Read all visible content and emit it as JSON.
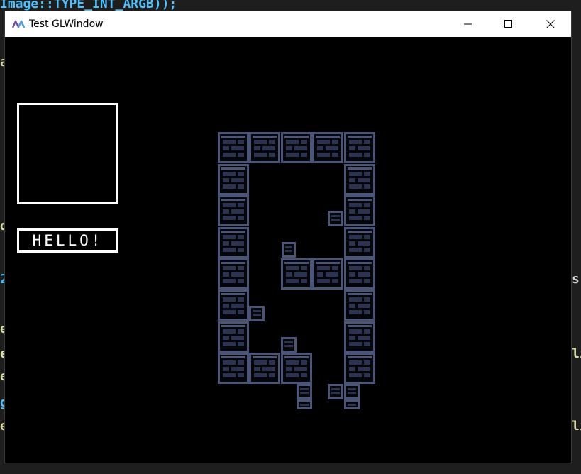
{
  "background": {
    "code_fragments": [
      {
        "text": "Image::TYPE_INT_ARGB));",
        "color": "#4fc1ff"
      },
      {
        "text": "a",
        "color": "#dcdcaa"
      },
      {
        "text": "d",
        "color": "#dcdcaa"
      },
      {
        "text": "2",
        "color": "#4fc1ff"
      },
      {
        "text": "s(",
        "color": "#d4d4d4"
      },
      {
        "text": "e",
        "color": "#dcdcaa"
      },
      {
        "text": "e",
        "color": "#dcdcaa"
      },
      {
        "text": "li",
        "color": "#dcdcaa"
      },
      {
        "text": "e",
        "color": "#dcdcaa"
      },
      {
        "text": "g",
        "color": "#4fc1ff"
      },
      {
        "text": "e",
        "color": "#dcdcaa"
      },
      {
        "text": "li",
        "color": "#dcdcaa"
      }
    ]
  },
  "window": {
    "title": "Test GLWindow",
    "app_icon": "jetbrains-icon",
    "controls": {
      "minimize": "minimize-icon",
      "maximize": "maximize-icon",
      "close": "close-icon"
    }
  },
  "hud": {
    "hello_text": "HELLO!"
  },
  "colors": {
    "tile_border": "#4a5578",
    "tile_fill": "#05060a",
    "brick": "#2b3350",
    "ui_white": "#ffffff"
  }
}
